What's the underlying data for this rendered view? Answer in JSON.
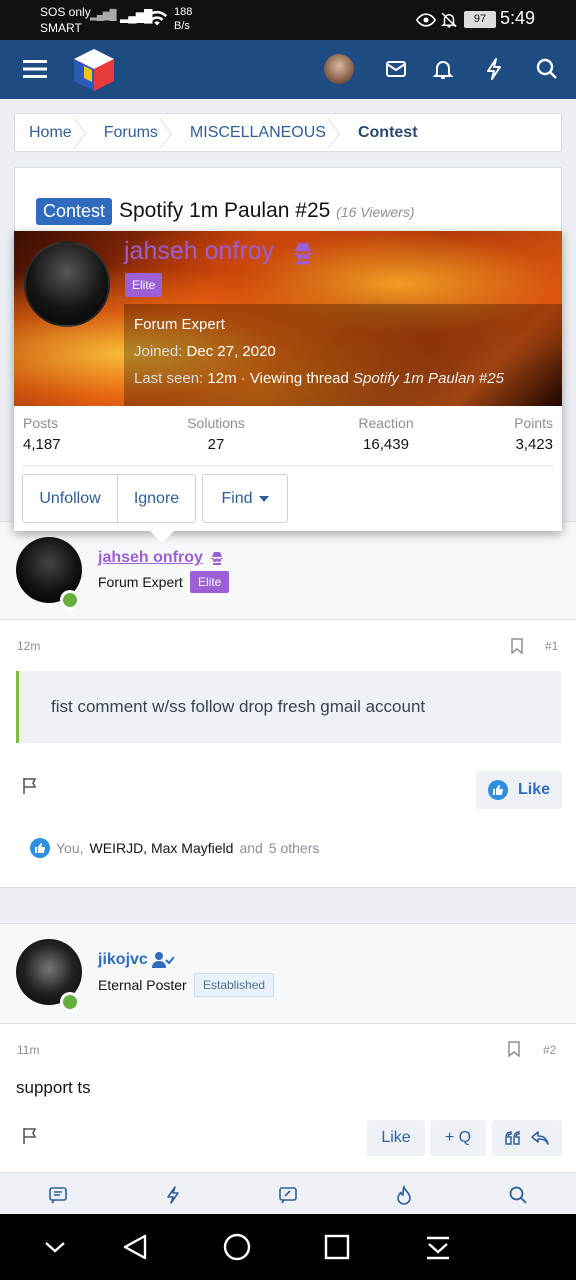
{
  "status_bar": {
    "carrier_line1": "SOS only",
    "carrier_line2": "SMART",
    "net_rate_value": "188",
    "net_rate_unit": "B/s",
    "battery": "97",
    "time": "5:49"
  },
  "header": {
    "icons": [
      "menu-icon",
      "site-logo",
      "user-avatar",
      "inbox-icon",
      "alerts-icon",
      "whats-new-icon",
      "search-icon"
    ]
  },
  "breadcrumb": [
    "Home",
    "Forums",
    "MISCELLANEOUS",
    "Contest"
  ],
  "thread": {
    "prefix": "Contest",
    "title": "Spotify 1m Paulan #25",
    "viewers": "(16 Viewers)"
  },
  "member_tooltip": {
    "name": "jahseh onfroy",
    "badge": "Elite",
    "user_title": "Forum Expert",
    "joined_label": "Joined:",
    "joined_value": "Dec 27, 2020",
    "last_seen_label": "Last seen:",
    "last_seen_value": "12m · Viewing thread",
    "last_seen_thread": "Spotify 1m Paulan #25",
    "stats": [
      {
        "label": "Posts",
        "value": "4,187"
      },
      {
        "label": "Solutions",
        "value": "27"
      },
      {
        "label": "Reaction",
        "value": "16,439"
      },
      {
        "label": "Points",
        "value": "3,423"
      }
    ],
    "buttons": {
      "unfollow": "Unfollow",
      "ignore": "Ignore",
      "find": "Find"
    }
  },
  "posts": [
    {
      "username": "jahseh onfroy",
      "user_title": "Forum Expert",
      "badge": "Elite",
      "time": "12m",
      "number": "#1",
      "content": "fist comment w/ss follow drop fresh gmail account",
      "like_label": "Like",
      "reactions": {
        "you": "You,",
        "names": "WEIRJD, Max Mayfield",
        "and": "and",
        "others": "5 others"
      }
    },
    {
      "username": "jikojvc",
      "user_title": "Eternal Poster",
      "badge": "Established",
      "time": "11m",
      "number": "#2",
      "content": "support ts",
      "like_label": "Like",
      "quote_label": "+ Q"
    }
  ],
  "app_nav": [
    "forums-icon",
    "whats-new-icon",
    "new-post-icon",
    "trending-icon",
    "search-icon"
  ],
  "colors": {
    "header": "#1f4b83",
    "accent": "#2f6cc0",
    "elite": "#9c5fd6",
    "online": "#63b03c",
    "quote_border": "#7bc043"
  }
}
